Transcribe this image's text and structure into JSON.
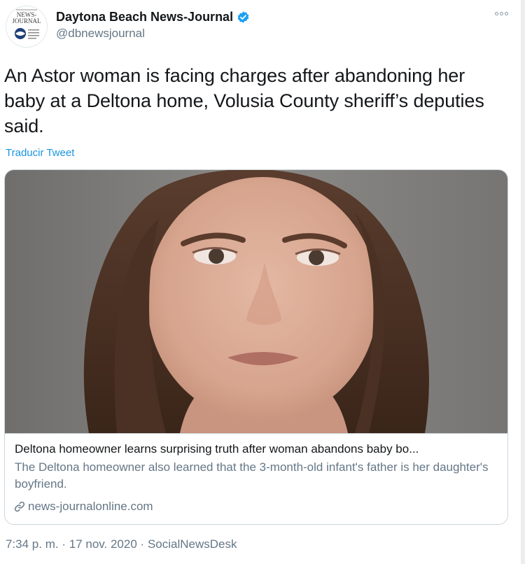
{
  "account": {
    "display_name": "Daytona Beach News-Journal",
    "handle": "@dbnewsjournal",
    "verified": true,
    "avatar_logo_text_line1": "NEWS-",
    "avatar_logo_text_line2": "JOURNAL"
  },
  "tweet": {
    "text": "An Astor woman is facing charges after abandoning her baby at a Deltona home, Volusia County sheriff’s deputies said.",
    "translate_label": "Traducir Tweet"
  },
  "card": {
    "title": "Deltona homeowner learns surprising truth after woman abandons baby bo...",
    "description": "The Deltona homeowner also learned that the 3-month-old infant's father is her daughter's boyfriend.",
    "domain": "news-journalonline.com",
    "image_subject": "mugshot photo of a woman with long brown hair"
  },
  "meta": {
    "time": "7:34 p. m.",
    "separator": "·",
    "date": "17 nov. 2020",
    "source": "SocialNewsDesk"
  },
  "colors": {
    "link_blue": "#1b95e0",
    "verified_blue": "#1da1f2",
    "secondary_text": "#657786",
    "border": "#ccd6dd"
  },
  "icons": {
    "verified": "verified-badge-icon",
    "more": "more-options-icon",
    "link": "link-icon"
  }
}
